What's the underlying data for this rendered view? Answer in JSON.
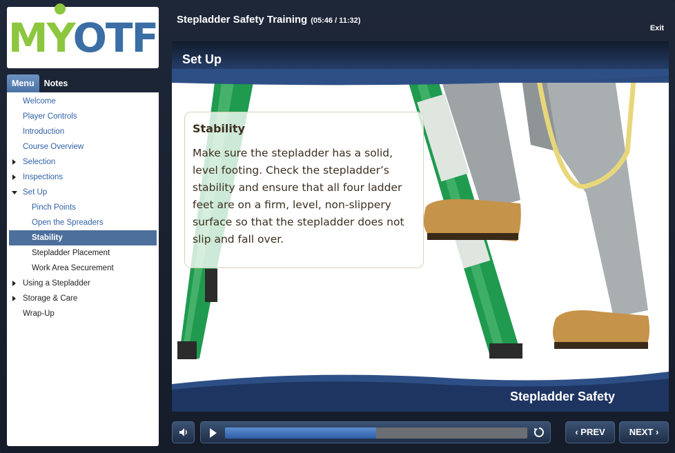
{
  "logo": {
    "text_m": "M",
    "text_y": "Y",
    "text_o": "O",
    "text_tf": "TF"
  },
  "header": {
    "title": "Stepladder Safety Training",
    "time": "(05:46 / 11:32)",
    "exit_label": "Exit"
  },
  "sidebar": {
    "tabs": [
      {
        "label": "Menu"
      },
      {
        "label": "Notes"
      }
    ],
    "items": [
      {
        "label": "Welcome"
      },
      {
        "label": "Player Controls"
      },
      {
        "label": "Introduction"
      },
      {
        "label": "Course Overview"
      },
      {
        "label": "Selection"
      },
      {
        "label": "Inspections"
      },
      {
        "label": "Set Up"
      },
      {
        "label": "Pinch Points"
      },
      {
        "label": "Open the Spreaders"
      },
      {
        "label": "Stability"
      },
      {
        "label": "Stepladder Placement"
      },
      {
        "label": "Work Area Securement"
      },
      {
        "label": "Using a Stepladder"
      },
      {
        "label": "Storage & Care"
      },
      {
        "label": "Wrap-Up"
      }
    ]
  },
  "slide": {
    "title": "Set Up",
    "callout_title": "Stability",
    "callout_body": "Make sure the stepladder has a solid, level footing. Check the stepladder’s stability and ensure that all four ladder feet are on a firm, level, non-slippery surface so that the stepladder does not slip and fall over.",
    "footer": "Stepladder Safety"
  },
  "controls": {
    "prev_label": "‹ PREV",
    "next_label": "NEXT ›",
    "progress": 0.5,
    "icons": [
      "volume-icon",
      "play-icon",
      "replay-icon"
    ]
  },
  "colors": {
    "accent": "#4d6f9c",
    "link": "#2f61a8",
    "ladder": "#1f9a4f",
    "progress": "#2d5fa8"
  }
}
